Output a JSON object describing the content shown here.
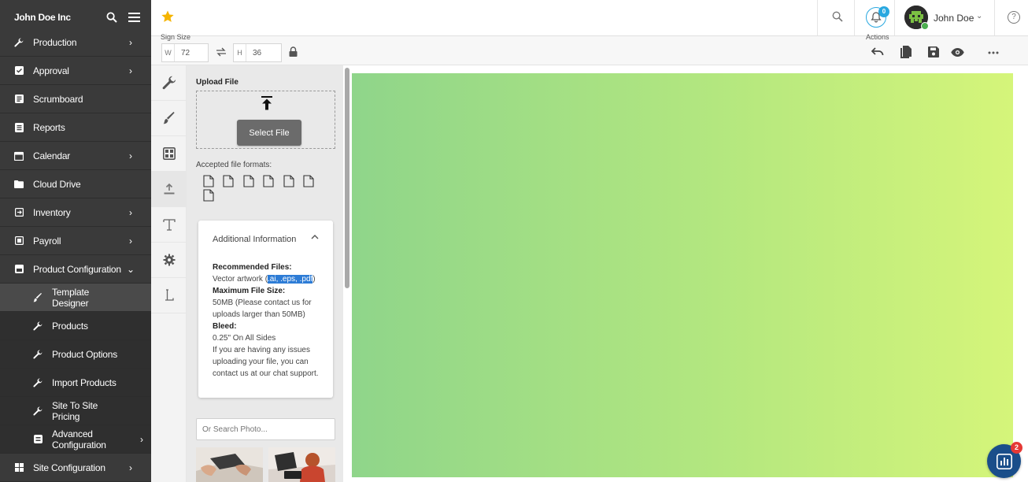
{
  "sidebar": {
    "brand": "John Doe Inc",
    "items": [
      {
        "label": "Production",
        "icon": "wrench-icon"
      },
      {
        "label": "Approval",
        "icon": "approval-icon"
      },
      {
        "label": "Scrumboard",
        "icon": "board-icon"
      },
      {
        "label": "Reports",
        "icon": "reports-icon"
      },
      {
        "label": "Calendar",
        "icon": "calendar-icon"
      },
      {
        "label": "Cloud Drive",
        "icon": "folder-icon"
      },
      {
        "label": "Inventory",
        "icon": "inventory-icon"
      },
      {
        "label": "Payroll",
        "icon": "payroll-icon"
      },
      {
        "label": "Product Configuration",
        "icon": "product-config-icon"
      },
      {
        "label": "Template Designer",
        "icon": "brush-icon"
      },
      {
        "label": "Products",
        "icon": "wrench-icon"
      },
      {
        "label": "Product Options",
        "icon": "wrench-icon"
      },
      {
        "label": "Import Products",
        "icon": "wrench-icon"
      },
      {
        "label": "Site To Site Pricing",
        "icon": "wrench-icon"
      },
      {
        "label": "Advanced Configuration",
        "icon": "advanced-config-icon"
      },
      {
        "label": "Site Configuration",
        "icon": "site-config-icon"
      }
    ]
  },
  "topbar": {
    "notifications_count": "0",
    "user_name": "John Doe",
    "help_glyph": "?"
  },
  "toolbar": {
    "sign_size_label": "Sign Size",
    "width_prefix": "W",
    "width_value": "72",
    "height_prefix": "H",
    "height_value": "36",
    "actions_label": "Actions"
  },
  "upload": {
    "title": "Upload File",
    "select_button": "Select File",
    "formats_label": "Accepted file formats:",
    "info_title": "Additional Information",
    "recommended_label": "Recommended Files:",
    "recommended_prefix": "Vector artwork (",
    "recommended_highlight": ".ai, .eps, .pdf",
    "recommended_suffix": ")",
    "max_size_label": "Maximum File Size:",
    "max_size_value": "50MB (Please contact us for uploads larger than 50MB)",
    "bleed_label": "Bleed:",
    "bleed_value": "0.25\" On All Sides",
    "help_text": "If you are having any issues uploading your file, you can contact us at our chat support.",
    "search_placeholder": "Or Search Photo..."
  },
  "chat": {
    "badge": "2"
  },
  "colors": {
    "sidebar_bg": "#3a3a3a",
    "accent": "#29a8e0",
    "star": "#f5b400",
    "artboard_start": "#8fd58a",
    "artboard_end": "#d5f57a",
    "highlight": "#2d7cd6",
    "chat_bg": "#1a4e8a"
  }
}
